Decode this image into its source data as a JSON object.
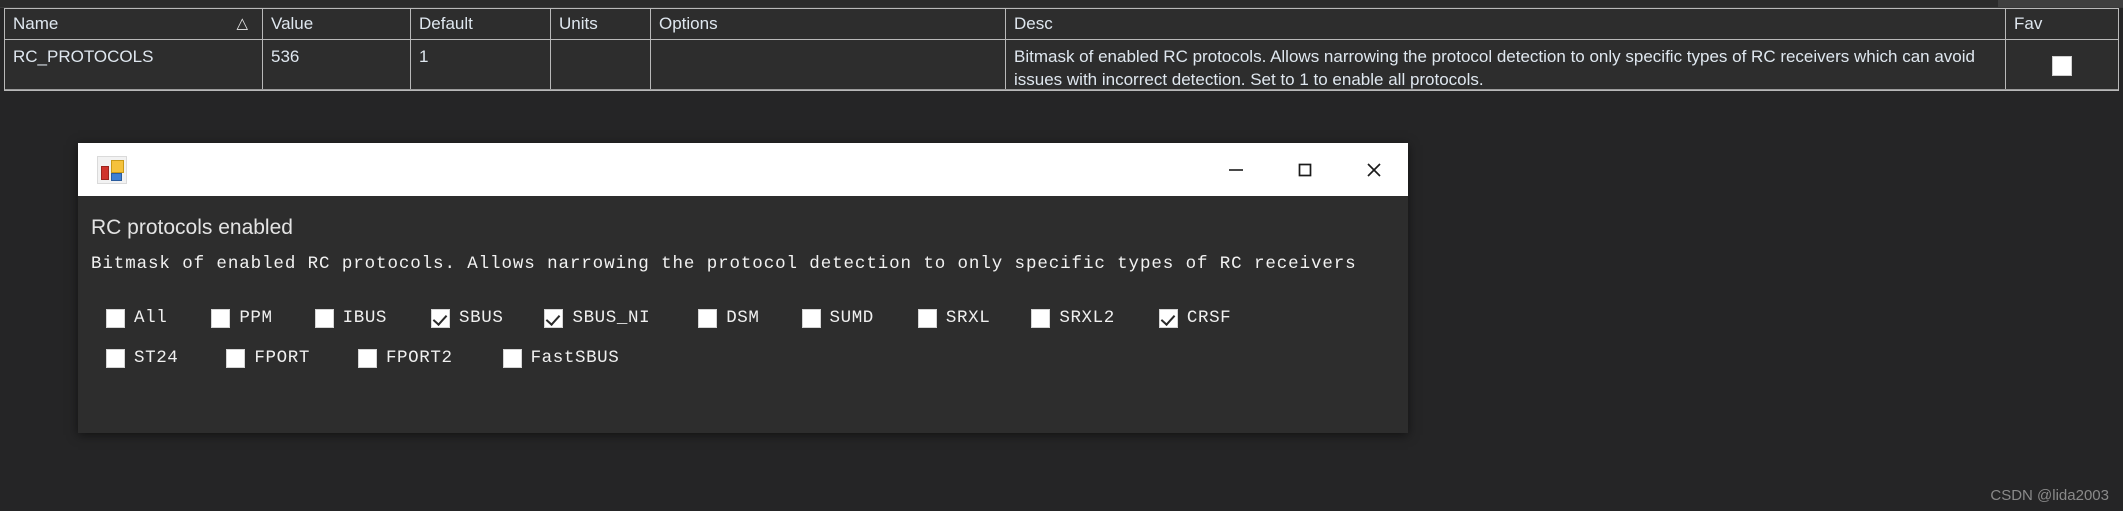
{
  "grid": {
    "columns": [
      {
        "key": "name",
        "label": "Name",
        "sort_glyph": "△"
      },
      {
        "key": "value",
        "label": "Value",
        "sort_glyph": ""
      },
      {
        "key": "default",
        "label": "Default",
        "sort_glyph": ""
      },
      {
        "key": "units",
        "label": "Units",
        "sort_glyph": ""
      },
      {
        "key": "options",
        "label": "Options",
        "sort_glyph": ""
      },
      {
        "key": "desc",
        "label": "Desc",
        "sort_glyph": ""
      },
      {
        "key": "fav",
        "label": "Fav",
        "sort_glyph": ""
      }
    ],
    "rows": [
      {
        "name": "RC_PROTOCOLS",
        "value": "536",
        "default": "1",
        "units": "",
        "options": "",
        "desc": "Bitmask of enabled RC protocols. Allows narrowing the protocol detection to only specific types of RC receivers which can avoid issues with incorrect detection. Set to 1 to enable all protocols.",
        "fav_checked": false
      }
    ]
  },
  "dialog": {
    "titlebar": {
      "title": "",
      "icon": "application-icon",
      "minimize_label": "minimize-icon",
      "maximize_label": "maximize-icon",
      "close_label": "close-icon"
    },
    "heading": "RC protocols enabled",
    "description": "Bitmask of enabled RC protocols. Allows narrowing the protocol detection to only specific types of RC receivers",
    "checkbox_rows": [
      [
        {
          "label": "All",
          "checked": false
        },
        {
          "label": "PPM",
          "checked": false
        },
        {
          "label": "IBUS",
          "checked": false
        },
        {
          "label": "SBUS",
          "checked": true
        },
        {
          "label": "SBUS_NI",
          "checked": true
        },
        {
          "label": "DSM",
          "checked": false
        },
        {
          "label": "SUMD",
          "checked": false
        },
        {
          "label": "SRXL",
          "checked": false
        },
        {
          "label": "SRXL2",
          "checked": false
        },
        {
          "label": "CRSF",
          "checked": true
        }
      ],
      [
        {
          "label": "ST24",
          "checked": false
        },
        {
          "label": "FPORT",
          "checked": false
        },
        {
          "label": "FPORT2",
          "checked": false
        },
        {
          "label": "FastSBUS",
          "checked": false
        }
      ]
    ]
  },
  "watermark": "CSDN @lida2003",
  "colors": {
    "app_background": "#252526",
    "grid_background": "#2d2d2d",
    "grid_border": "#b9b9b9",
    "grid_text": "#dfe7ef",
    "titlebar_background": "#ffffff",
    "dialog_background": "#2d2d2d",
    "dialog_text": "#f0f0f0",
    "checkbox_fill": "#ffffff",
    "checkmark": "#2a2a2a"
  }
}
